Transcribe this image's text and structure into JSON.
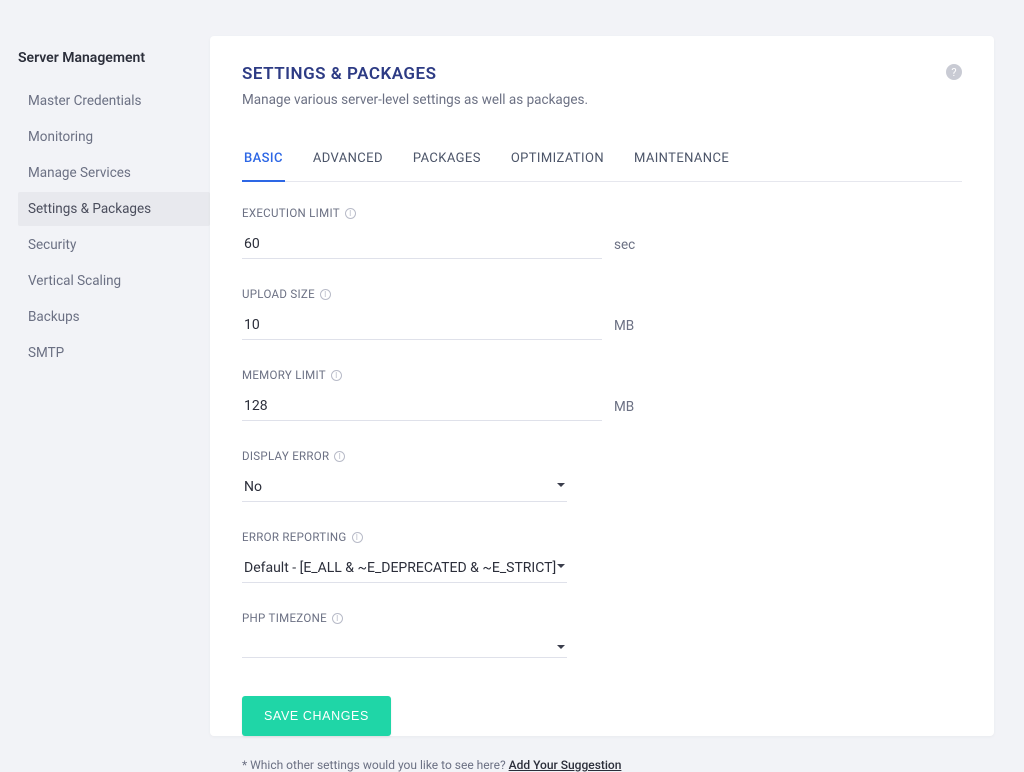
{
  "sidebar": {
    "title": "Server Management",
    "items": [
      {
        "label": "Master Credentials",
        "active": false
      },
      {
        "label": "Monitoring",
        "active": false
      },
      {
        "label": "Manage Services",
        "active": false
      },
      {
        "label": "Settings & Packages",
        "active": true
      },
      {
        "label": "Security",
        "active": false
      },
      {
        "label": "Vertical Scaling",
        "active": false
      },
      {
        "label": "Backups",
        "active": false
      },
      {
        "label": "SMTP",
        "active": false
      }
    ]
  },
  "header": {
    "title": "SETTINGS & PACKAGES",
    "subtitle": "Manage various server-level settings as well as packages."
  },
  "tabs": [
    {
      "label": "BASIC",
      "active": true
    },
    {
      "label": "ADVANCED",
      "active": false
    },
    {
      "label": "PACKAGES",
      "active": false
    },
    {
      "label": "OPTIMIZATION",
      "active": false
    },
    {
      "label": "MAINTENANCE",
      "active": false
    }
  ],
  "form": {
    "execution_limit": {
      "label": "EXECUTION LIMIT",
      "value": "60",
      "unit": "sec"
    },
    "upload_size": {
      "label": "UPLOAD SIZE",
      "value": "10",
      "unit": "MB"
    },
    "memory_limit": {
      "label": "MEMORY LIMIT",
      "value": "128",
      "unit": "MB"
    },
    "display_error": {
      "label": "DISPLAY ERROR",
      "value": "No"
    },
    "error_reporting": {
      "label": "ERROR REPORTING",
      "value": "Default - [E_ALL & ~E_DEPRECATED & ~E_STRICT]"
    },
    "php_timezone": {
      "label": "PHP TIMEZONE",
      "value": ""
    }
  },
  "actions": {
    "save": "SAVE CHANGES"
  },
  "footnote": {
    "prefix": "* Which other settings would you like to see here? ",
    "link": "Add Your Suggestion"
  }
}
